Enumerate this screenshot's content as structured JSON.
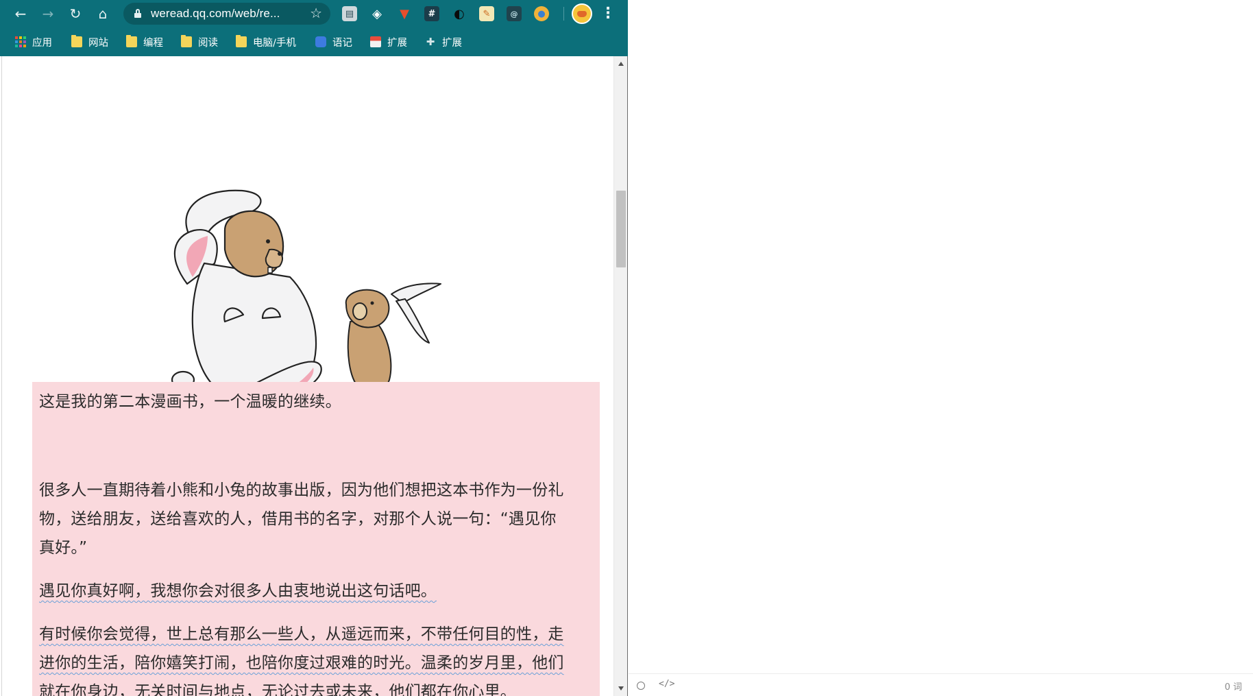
{
  "browser": {
    "url": "weread.qq.com/web/re...",
    "bookmarks": [
      {
        "label": "应用",
        "icon": "apps-grid-icon"
      },
      {
        "label": "网站",
        "icon": "folder-icon"
      },
      {
        "label": "编程",
        "icon": "folder-icon"
      },
      {
        "label": "阅读",
        "icon": "folder-icon"
      },
      {
        "label": "电脑/手机",
        "icon": "folder-icon"
      },
      {
        "label": "语记",
        "icon": "note-app-icon"
      },
      {
        "label": "扩展",
        "icon": "store-icon"
      },
      {
        "label": "扩展",
        "icon": "puzzle-icon"
      }
    ],
    "theme_color": "#0c6f7a"
  },
  "page": {
    "highlight_color": "#fad9dd",
    "paragraphs": [
      "这是我的第二本漫画书，一个温暖的继续。",
      "很多人一直期待着小熊和小兔的故事出版，因为他们想把这本书作为一份礼",
      "物，送给朋友，送给喜欢的人，借用书的名字，对那个人说一句：“遇见你",
      "真好。”",
      "遇见你真好啊，我想你会对很多人由衷地说出这句话吧。",
      "有时候你会觉得，世上总有那么一些人，从遥远而来，不带任何目的性，走",
      "进你的生活，陪你嬉笑打闹，也陪你度过艰难的时光。温柔的岁月里，他们",
      "就在你身边，无关时间与地点，无论过去或未来，他们都在你心里。"
    ]
  },
  "editor": {
    "word_count": "0 词",
    "code_toggle": "</>"
  }
}
